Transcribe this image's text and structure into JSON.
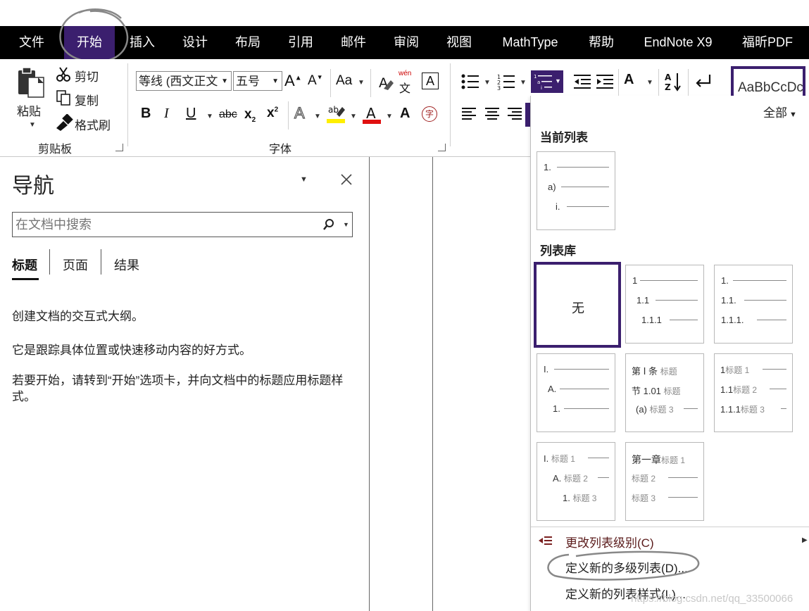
{
  "menu": {
    "items": [
      "文件",
      "开始",
      "插入",
      "设计",
      "布局",
      "引用",
      "邮件",
      "审阅",
      "视图",
      "MathType",
      "帮助",
      "EndNote X9",
      "福昕PDF"
    ],
    "active_index": 1
  },
  "ribbon": {
    "clipboard": {
      "paste": "粘贴",
      "cut": "剪切",
      "copy": "复制",
      "format_painter": "格式刷",
      "group_label": "剪贴板"
    },
    "font": {
      "font_name": "等线 (西文正文",
      "font_size": "五号",
      "change_case": "Aa",
      "phonetic_top": "wén",
      "phonetic_bottom": "文",
      "bold": "B",
      "italic": "I",
      "underline": "U",
      "strike": "abc",
      "subscript": "x",
      "superscript": "x",
      "char_border": "A",
      "enclose": "字",
      "group_label": "字体"
    },
    "style_preview": "AaBbCcDc"
  },
  "nav": {
    "title": "导航",
    "search_placeholder": "在文档中搜索",
    "tabs": [
      "标题",
      "页面",
      "结果"
    ],
    "active_tab": 0,
    "para1": "创建文档的交互式大纲。",
    "para2": "它是跟踪具体位置或快速移动内容的好方式。",
    "para3": "若要开始，请转到“开始”选项卡，并向文档中的标题应用标题样式。"
  },
  "dropdown": {
    "filter": "全部",
    "current_list_title": "当前列表",
    "current_list_levels": [
      "1.",
      "a)",
      "i."
    ],
    "library_title": "列表库",
    "tiles": {
      "none": "无",
      "t2": [
        "1",
        "1.1",
        "1.1.1"
      ],
      "t3": [
        "1.",
        "1.1.",
        "1.1.1."
      ],
      "t4": [
        "I.",
        "A.",
        "1."
      ],
      "t5": [
        {
          "num": "第 Ⅰ 条",
          "text": "标题"
        },
        {
          "num": "节 1.01",
          "text": "标题"
        },
        {
          "num": "(a)",
          "text": "标题 3"
        }
      ],
      "t6": [
        {
          "num": "1",
          "text": "标题 1"
        },
        {
          "num": "1.1",
          "text": "标题 2"
        },
        {
          "num": "1.1.1",
          "text": "标题 3"
        }
      ],
      "t7": [
        {
          "num": "I.",
          "text": "标题 1"
        },
        {
          "num": "A.",
          "text": "标题 2"
        },
        {
          "num": "1.",
          "text": "标题 3"
        }
      ],
      "t8": [
        {
          "num": "第一章",
          "text": "标题 1"
        },
        {
          "num": "",
          "text": "标题 2"
        },
        {
          "num": "",
          "text": "标题 3"
        }
      ]
    },
    "cmd_change_level": "更改列表级别(C)",
    "cmd_define_multilevel": "定义新的多级列表(D)...",
    "cmd_define_style": "定义新的列表样式(L)..."
  },
  "watermark": "https://blog.csdn.net/qq_33500066"
}
